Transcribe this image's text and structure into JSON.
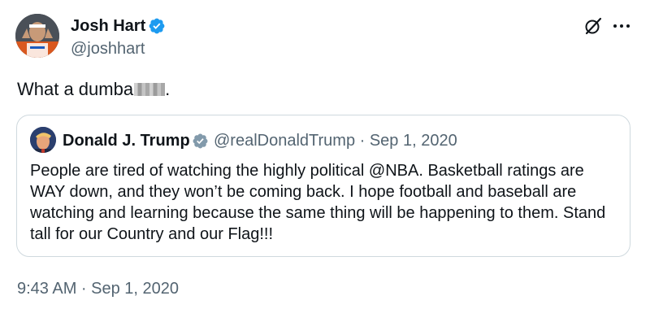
{
  "post": {
    "author_name": "Josh Hart",
    "author_handle": "@joshhart",
    "text": "What a dumba",
    "text_suffix": ".",
    "timestamp": "9:43 AM · Sep 1, 2020"
  },
  "quoted_post": {
    "author_name": "Donald J. Trump",
    "meta": "@realDonaldTrump · Sep 1, 2020",
    "text": "People are tired of watching the highly political @NBA. Basketball ratings are WAY down, and they won’t be coming back. I hope football and baseball are watching and learning because the same thing will be happening to them. Stand tall for our Country and our Flag!!!"
  },
  "icons": {
    "verified": "verified-badge-icon",
    "grok": "grok-icon",
    "more": "more-options-icon"
  },
  "colors": {
    "verified_blue": "#1d9bf0",
    "secondary_text": "#536471",
    "primary_text": "#0f1419",
    "border": "#cfd9de"
  }
}
